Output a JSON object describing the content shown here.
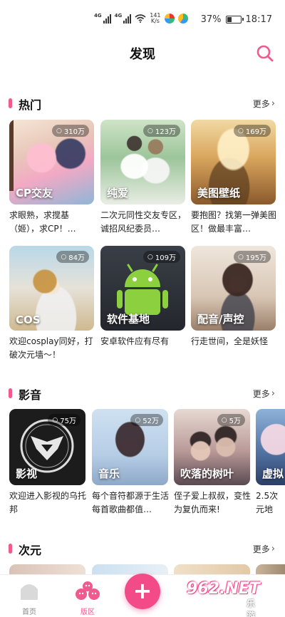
{
  "status_bar": {
    "network_1": "4G",
    "network_2": "4G",
    "speed_value": "141",
    "speed_unit": "K/s",
    "battery": "37%",
    "battery_level": 0.37,
    "time": "18:17"
  },
  "header": {
    "title": "发现"
  },
  "sections": [
    {
      "title": "热门",
      "more": "更多",
      "cards": [
        {
          "label": "CP交友",
          "count": "310万",
          "desc": "求眼熟，求搅基（姬），求CP！…"
        },
        {
          "label": "纯爱",
          "count": "123万",
          "desc": "二次元同性交友专区，诚招风纪委员…"
        },
        {
          "label": "美图壁纸",
          "count": "169万",
          "desc": "要抱图？找第一弹美图区！做最丰富…"
        },
        {
          "label": "COS",
          "count": "84万",
          "desc": "欢迎cosplay同好，打破次元墙～！"
        },
        {
          "label": "软件基地",
          "count": "109万",
          "desc": "安卓软件应有尽有"
        },
        {
          "label": "配音/声控",
          "count": "195万",
          "desc": "行走世间，全是妖怪"
        }
      ]
    },
    {
      "title": "影音",
      "more": "更多",
      "cards": [
        {
          "label": "影视",
          "count": "75万",
          "desc": "欢迎进入影视的乌托邦"
        },
        {
          "label": "音乐",
          "count": "52万",
          "desc": "每个音符都源于生活 每首歌曲都值…"
        },
        {
          "label": "吹落的树叶",
          "count": "5万",
          "desc": "侄子爱上叔叔，变性为复仇而来!"
        },
        {
          "label": "虚拟",
          "count": "",
          "desc": "2.5次元地"
        }
      ]
    },
    {
      "title": "次元",
      "more": "更多"
    }
  ],
  "bottom_nav": {
    "home": "首页",
    "forum": "版区",
    "post_plus": "+"
  },
  "watermark": {
    "text": "962.NET",
    "sub": "乐游网"
  },
  "icons": {
    "search": "search-icon",
    "more": "chevron-right-icon",
    "count": "person-icon",
    "home": "home-icon",
    "forum": "forum-icon",
    "post": "plus-icon"
  },
  "colors": {
    "accent": "#f05a8c",
    "fab": "#f24b87"
  }
}
